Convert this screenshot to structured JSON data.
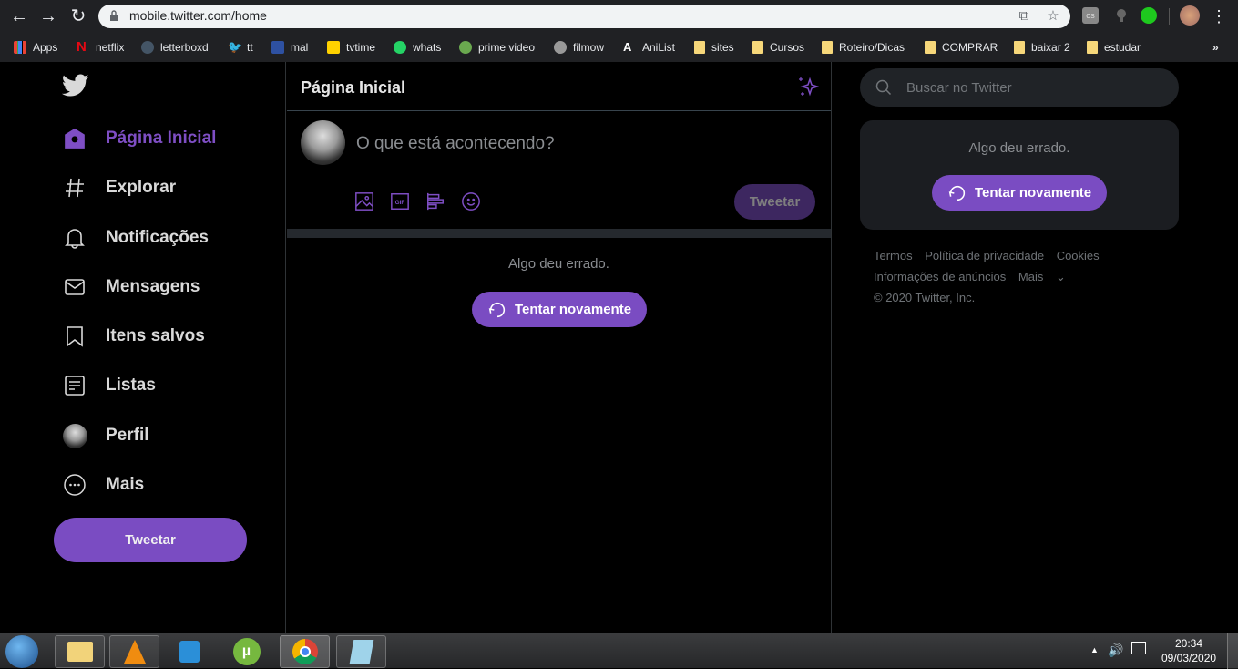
{
  "browser": {
    "url": "mobile.twitter.com/home",
    "nav": {
      "back_icon": "arrow-left-icon",
      "forward_icon": "arrow-right-icon",
      "reload_icon": "reload-icon"
    },
    "omnibox_icons": [
      "open-external-icon",
      "star-icon"
    ],
    "extensions": [
      "lastfm-icon",
      "lightbulb-icon",
      "thumbs-up-icon",
      "profile-avatar",
      "kebab-menu-icon"
    ],
    "bookmarks": [
      {
        "label": "Apps",
        "icon": "apps-grid-icon"
      },
      {
        "label": "netflix",
        "icon": "netflix-icon"
      },
      {
        "label": "letterboxd",
        "icon": "letterboxd-icon"
      },
      {
        "label": "tt",
        "icon": "twitter-icon"
      },
      {
        "label": "mal",
        "icon": "mal-icon"
      },
      {
        "label": "tvtime",
        "icon": "tvtime-icon"
      },
      {
        "label": "whats",
        "icon": "whatsapp-icon"
      },
      {
        "label": "prime video",
        "icon": "prime-video-icon"
      },
      {
        "label": "filmow",
        "icon": "filmow-icon"
      },
      {
        "label": "AniList",
        "icon": "anilist-icon"
      },
      {
        "label": "sites",
        "icon": "folder-icon"
      },
      {
        "label": "Cursos",
        "icon": "folder-icon"
      },
      {
        "label": "Roteiro/Dicas",
        "icon": "folder-icon"
      },
      {
        "label": "COMPRAR",
        "icon": "folder-icon"
      },
      {
        "label": "baixar 2",
        "icon": "folder-icon"
      },
      {
        "label": "estudar",
        "icon": "folder-icon"
      }
    ],
    "overflow": "»"
  },
  "sidebar": {
    "logo": "twitter-bird-icon",
    "items": [
      {
        "label": "Página Inicial",
        "icon": "home-icon",
        "active": true
      },
      {
        "label": "Explorar",
        "icon": "hashtag-icon"
      },
      {
        "label": "Notificações",
        "icon": "bell-icon"
      },
      {
        "label": "Mensagens",
        "icon": "envelope-icon"
      },
      {
        "label": "Itens salvos",
        "icon": "bookmark-icon"
      },
      {
        "label": "Listas",
        "icon": "list-icon"
      },
      {
        "label": "Perfil",
        "icon": "profile-avatar"
      },
      {
        "label": "Mais",
        "icon": "more-circle-icon"
      }
    ],
    "tweet_button": "Tweetar"
  },
  "main": {
    "title": "Página Inicial",
    "sparkle_icon": "sparkle-icon",
    "compose": {
      "placeholder": "O que está acontecendo?",
      "icons": [
        "image-icon",
        "gif-icon",
        "poll-icon",
        "emoji-icon"
      ],
      "tweet_button": "Tweetar"
    },
    "error": {
      "message": "Algo deu errado.",
      "retry": "Tentar novamente"
    }
  },
  "right": {
    "search_placeholder": "Buscar no Twitter",
    "error": {
      "message": "Algo deu errado.",
      "retry": "Tentar novamente"
    },
    "footer": {
      "links": [
        "Termos",
        "Política de privacidade",
        "Cookies",
        "Informações de anúncios",
        "Mais"
      ],
      "copyright": "© 2020 Twitter, Inc."
    }
  },
  "colors": {
    "accent": "#7a4cc2",
    "background": "#000000",
    "card": "#1b1d21"
  },
  "taskbar": {
    "apps": [
      "windows-start-icon",
      "file-explorer-icon",
      "vlc-icon",
      "media-player-icon",
      "utorrent-icon",
      "chrome-icon",
      "notepad-icon"
    ],
    "time": "20:34",
    "date": "09/03/2020"
  }
}
